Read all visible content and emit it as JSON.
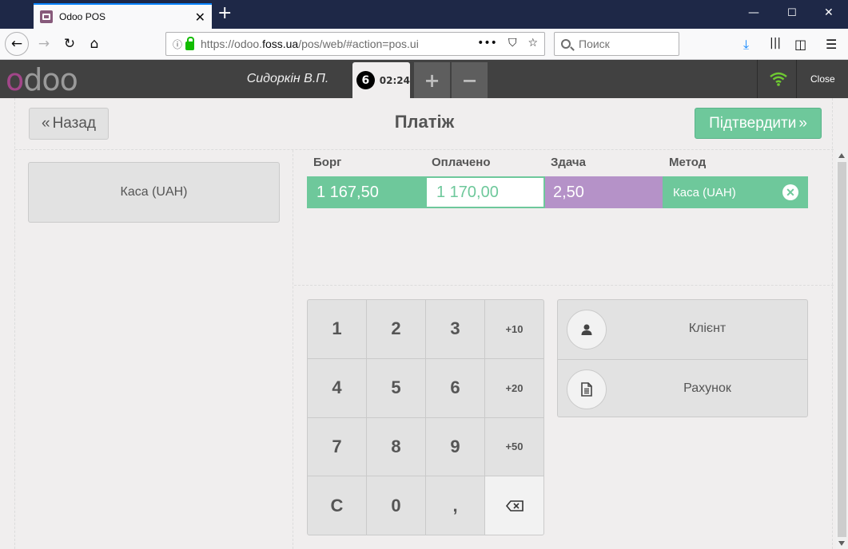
{
  "browser": {
    "tab_title": "Odoo POS",
    "url_host": "https://odoo.",
    "url_domain": "foss.ua",
    "url_path": "/pos/web/#action=pos.ui",
    "search_placeholder": "Поиск"
  },
  "pos": {
    "cashier": "Сидоркін В.П.",
    "order_number": "6",
    "order_time": "02:24",
    "add_order": "+",
    "remove_order": "−",
    "close_label": "Close"
  },
  "payment": {
    "back_label": "Назад",
    "title": "Платіж",
    "validate_label": "Підтвердити",
    "methods": [
      "Каса (UAH)"
    ],
    "columns": {
      "due": "Борг",
      "tendered": "Оплачено",
      "change": "Здача",
      "method": "Метод"
    },
    "line": {
      "due": "1 167,50",
      "tendered": "1 170,00",
      "change": "2,50",
      "method": "Каса (UAH)"
    },
    "numpad": [
      "1",
      "2",
      "3",
      "+10",
      "4",
      "5",
      "6",
      "+20",
      "7",
      "8",
      "9",
      "+50",
      "C",
      "0",
      ","
    ],
    "options": {
      "customer": "Клієнт",
      "invoice": "Рахунок"
    }
  },
  "colors": {
    "accent_green": "#6ec89b",
    "change_purple": "#b592c8",
    "odoo_purple": "#a24689"
  }
}
